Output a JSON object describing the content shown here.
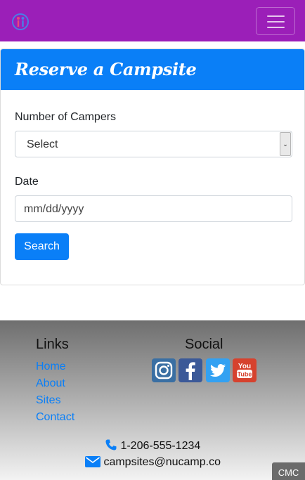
{
  "navbar": {
    "background_color": "#9b1fb8",
    "logo_icon": "nucamp-logo-icon",
    "menu_icon": "hamburger-menu-icon"
  },
  "reserve": {
    "title": "Reserve a Campsite",
    "header_color": "#0a7ff7",
    "campers_label": "Number of Campers",
    "campers_selected": "Select",
    "date_label": "Date",
    "date_placeholder": "mm/dd/yyyy",
    "search_button": "Search"
  },
  "footer": {
    "links_heading": "Links",
    "links": [
      "Home",
      "About",
      "Sites",
      "Contact"
    ],
    "social_heading": "Social",
    "social_icons": [
      "instagram-icon",
      "facebook-icon",
      "twitter-icon",
      "youtube-icon"
    ],
    "phone": "1-206-555-1234",
    "email": "campsites@nucamp.co",
    "badge": "CMC"
  }
}
